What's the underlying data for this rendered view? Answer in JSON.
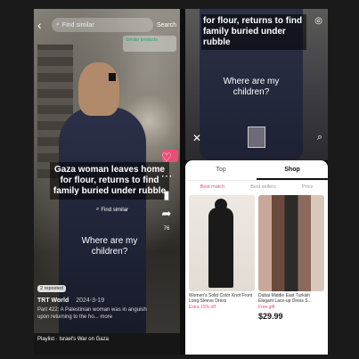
{
  "left_phone": {
    "search": {
      "label": "Find similar",
      "button": "Search"
    },
    "shop_tag": "Similar products",
    "headline": "Gaza woman leaves home for flour, returns to find family buried under rubble",
    "find_similar": "Find similar",
    "subtitle": "Where are my children?",
    "side": {
      "likes": "",
      "comments": "",
      "saves": "",
      "shares": "76"
    },
    "repost": "2 reposted",
    "channel": "TRT World",
    "date": "2024-3-19",
    "caption": "Part 422: A Palestinian woman was in anguish upon returning to the ho... more",
    "playlist": "Playlist · Israel's War on Gaza"
  },
  "right_phone": {
    "headline": "for flour, returns to find family buried under rubble",
    "subtitle": "Where are my children?",
    "tabs": [
      {
        "label": "Top",
        "active": false
      },
      {
        "label": "Shop",
        "active": true
      }
    ],
    "filters": [
      {
        "label": "Best match",
        "active": true
      },
      {
        "label": "Best sellers",
        "active": false
      },
      {
        "label": "Price",
        "active": false
      }
    ],
    "products": [
      {
        "title": "Women's Solid Color Knot Front Long Sleeve Dress",
        "price": "",
        "badge": "Extra 15% off"
      },
      {
        "title": "Dubai Middle East Turkish Elegant Lace-up Dress S...",
        "price": "$29.99",
        "badge": "Free gift"
      }
    ]
  },
  "icons": {
    "back": "arrow-left-icon",
    "close": "close-icon",
    "search": "search-icon",
    "heart": "heart-icon",
    "comment": "comment-icon",
    "bookmark": "bookmark-icon",
    "share": "share-icon"
  },
  "colors": {
    "accent": "#e94e77",
    "dark": "#0e0e0e",
    "sheet": "#ffffff"
  }
}
